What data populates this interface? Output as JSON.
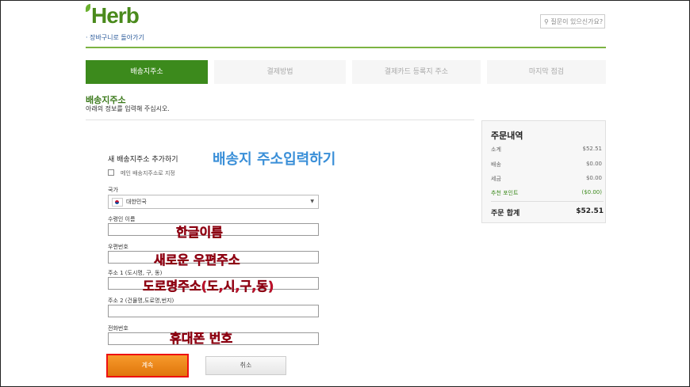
{
  "header": {
    "logo_text": "Herb",
    "back_link": "· 장바구니로 돌아가기",
    "search_placeholder": "질문이 있으신가요?"
  },
  "steps": [
    {
      "label": "배송지주소",
      "active": true
    },
    {
      "label": "결제방법",
      "active": false
    },
    {
      "label": "결제카드 등록지 주소",
      "active": false
    },
    {
      "label": "마지막 점검",
      "active": false
    }
  ],
  "section": {
    "title": "배송지주소",
    "subtitle": "아래의 정보를 입력해 주십시오."
  },
  "form": {
    "title": "새 배송지주소 추가하기",
    "default_checkbox_label": "메인 배송지주소로 지정",
    "country_label": "국가",
    "country_value": "대한민국",
    "recipient_label": "수령인 이름",
    "postcode_label": "우편번호",
    "address1_label": "주소 1 (도시명, 구, 동)",
    "address2_label": "주소 2 (건물명,도로명,번지)",
    "phone_label": "전화번호",
    "continue_label": "계속",
    "cancel_label": "취소"
  },
  "annotations": {
    "title_note": "배송지 주소입력하기",
    "name_note": "한글이름",
    "postcode_note": "새로운 우편주소",
    "address_note": "도로명주소(도,시,구,동)",
    "phone_note": "휴대폰 번호"
  },
  "summary": {
    "title": "주문내역",
    "rows": [
      {
        "label": "소계",
        "value": "$52.51"
      },
      {
        "label": "배송",
        "value": "$0.00"
      },
      {
        "label": "세금",
        "value": "$0.00"
      },
      {
        "label": "추천 포인트",
        "value": "($0.00)"
      }
    ],
    "total_label": "주문 합계",
    "total_value": "$52.51"
  },
  "colors": {
    "brand_green": "#3c8a1c",
    "continue_orange": "#f08a1c",
    "annotation_red": "#c8102e",
    "annotation_blue": "#3a8fd8"
  }
}
